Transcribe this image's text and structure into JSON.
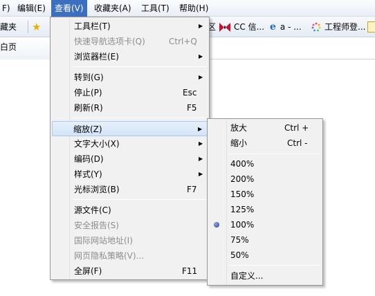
{
  "menubar": {
    "items": [
      "F)",
      "编辑(E)",
      "查看(V)",
      "收藏夹(A)",
      "工具(T)",
      "帮助(H)"
    ]
  },
  "favbar": {
    "favorites_label": "藏夹",
    "items": [
      {
        "icon": "page-icon",
        "label": "区"
      },
      {
        "icon": "bowtie-icon",
        "label": "CC 信..."
      },
      {
        "icon": "ie-icon",
        "label": "a - ..."
      },
      {
        "icon": "spinner-icon",
        "label": "工程师登..."
      }
    ]
  },
  "tab": {
    "label": "空白页"
  },
  "view_menu": {
    "items": [
      {
        "label": "工具栏(T)",
        "shortcut": "",
        "submenu": true,
        "disabled": false
      },
      {
        "label": "快速导航选项卡(Q)",
        "shortcut": "Ctrl+Q",
        "submenu": false,
        "disabled": true
      },
      {
        "label": "浏览器栏(E)",
        "shortcut": "",
        "submenu": true,
        "disabled": false
      },
      {
        "label": "转到(G)",
        "shortcut": "",
        "submenu": true,
        "disabled": false
      },
      {
        "label": "停止(P)",
        "shortcut": "Esc",
        "submenu": false,
        "disabled": false
      },
      {
        "label": "刷新(R)",
        "shortcut": "F5",
        "submenu": false,
        "disabled": false
      },
      {
        "label": "缩放(Z)",
        "shortcut": "",
        "submenu": true,
        "disabled": false
      },
      {
        "label": "文字大小(X)",
        "shortcut": "",
        "submenu": true,
        "disabled": false
      },
      {
        "label": "编码(D)",
        "shortcut": "",
        "submenu": true,
        "disabled": false
      },
      {
        "label": "样式(Y)",
        "shortcut": "",
        "submenu": true,
        "disabled": false
      },
      {
        "label": "光标浏览(B)",
        "shortcut": "F7",
        "submenu": false,
        "disabled": false
      },
      {
        "label": "源文件(C)",
        "shortcut": "",
        "submenu": false,
        "disabled": false
      },
      {
        "label": "安全报告(S)",
        "shortcut": "",
        "submenu": false,
        "disabled": true
      },
      {
        "label": "国际网站地址(I)",
        "shortcut": "",
        "submenu": false,
        "disabled": true
      },
      {
        "label": "网页隐私策略(V)...",
        "shortcut": "",
        "submenu": false,
        "disabled": true
      },
      {
        "label": "全屏(F)",
        "shortcut": "F11",
        "submenu": false,
        "disabled": false
      }
    ]
  },
  "zoom_menu": {
    "zoom_in": {
      "label": "放大",
      "shortcut": "Ctrl +"
    },
    "zoom_out": {
      "label": "缩小",
      "shortcut": "Ctrl -"
    },
    "levels": [
      "400%",
      "200%",
      "150%",
      "125%",
      "100%",
      "75%",
      "50%"
    ],
    "selected": "100%",
    "custom": "自定义..."
  },
  "colors": {
    "menubar_active": "#3b6fbf",
    "highlight_border": "#a8c8ec"
  }
}
